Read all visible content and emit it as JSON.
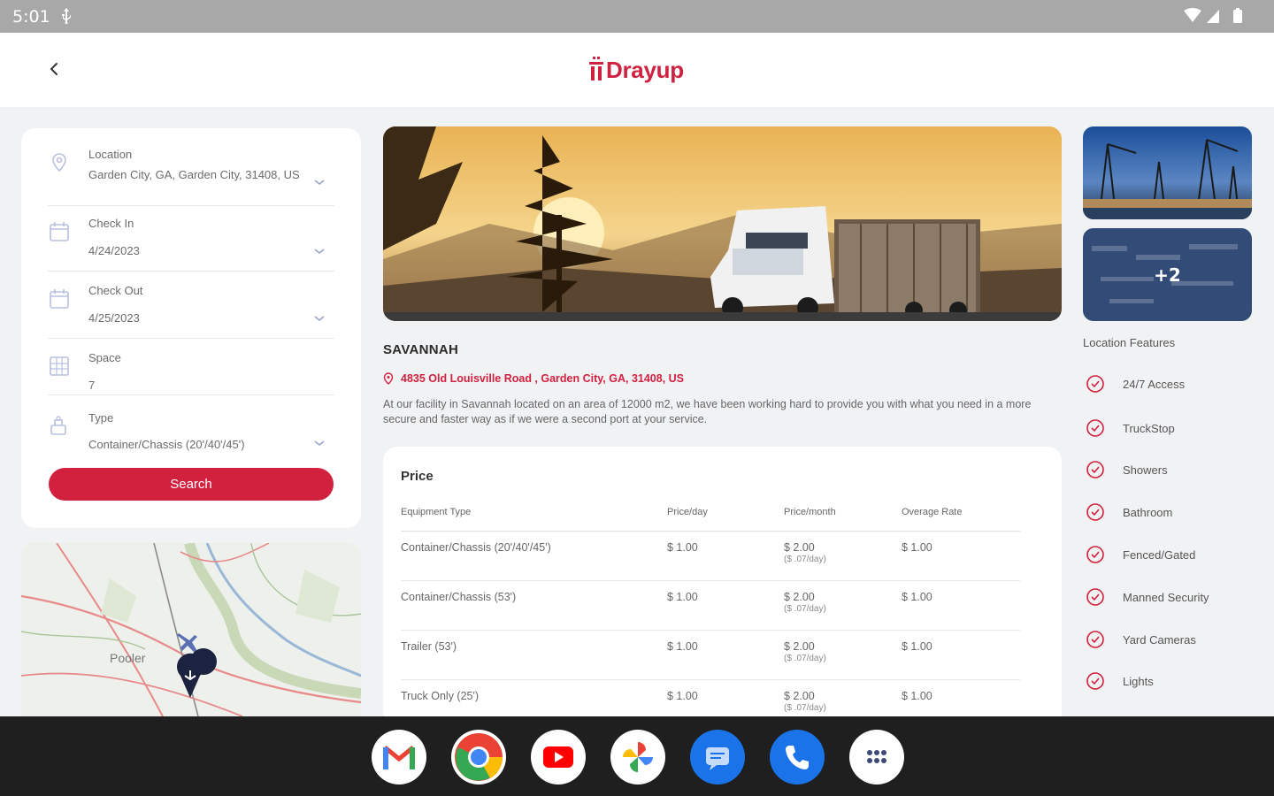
{
  "status_bar": {
    "time": "5:01"
  },
  "header": {
    "logo_text": "Drayup"
  },
  "filters": {
    "location": {
      "label": "Location",
      "value": "Garden City, GA, Garden City, 31408, US"
    },
    "check_in": {
      "label": "Check In",
      "value": "4/24/2023"
    },
    "check_out": {
      "label": "Check Out",
      "value": "4/25/2023"
    },
    "space": {
      "label": "Space",
      "value": "7"
    },
    "type": {
      "label": "Type",
      "value": "Container/Chassis (20'/40'/45')"
    },
    "search_label": "Search"
  },
  "map": {
    "place_label": "Pooler"
  },
  "listing": {
    "title": "SAVANNAH",
    "address": "4835 Old Louisville Road , Garden City, GA, 31408, US",
    "description": "At our facility in Savannah located on an area of 12000 m2, we have been working hard to provide you with what you need in a more secure and faster way as if we were a second port at your service."
  },
  "price": {
    "title": "Price",
    "headers": [
      "Equipment Type",
      "Price/day",
      "Price/month",
      "Overage Rate"
    ],
    "rows": [
      {
        "type": "Container/Chassis (20'/40'/45')",
        "day": "$ 1.00",
        "month": "$ 2.00",
        "month_sub": "($ .07/day)",
        "overage": "$ 1.00"
      },
      {
        "type": "Container/Chassis (53')",
        "day": "$ 1.00",
        "month": "$ 2.00",
        "month_sub": "($ .07/day)",
        "overage": "$ 1.00"
      },
      {
        "type": "Trailer (53')",
        "day": "$ 1.00",
        "month": "$ 2.00",
        "month_sub": "($ .07/day)",
        "overage": "$ 1.00"
      },
      {
        "type": "Truck Only (25')",
        "day": "$ 1.00",
        "month": "$ 2.00",
        "month_sub": "($ .07/day)",
        "overage": "$ 1.00"
      }
    ]
  },
  "gallery": {
    "more_label": "+2"
  },
  "features": {
    "title": "Location Features",
    "items": [
      "24/7 Access",
      "TruckStop",
      "Showers",
      "Bathroom",
      "Fenced/Gated",
      "Manned Security",
      "Yard Cameras",
      "Lights"
    ]
  },
  "dock": {
    "apps": [
      "gmail-icon",
      "chrome-icon",
      "youtube-icon",
      "photos-icon",
      "messages-icon",
      "phone-icon",
      "app-drawer-icon"
    ]
  },
  "colors": {
    "brand": "#d2213f",
    "status_bar": "#a8a8a8",
    "dock": "#1f1f1f"
  }
}
